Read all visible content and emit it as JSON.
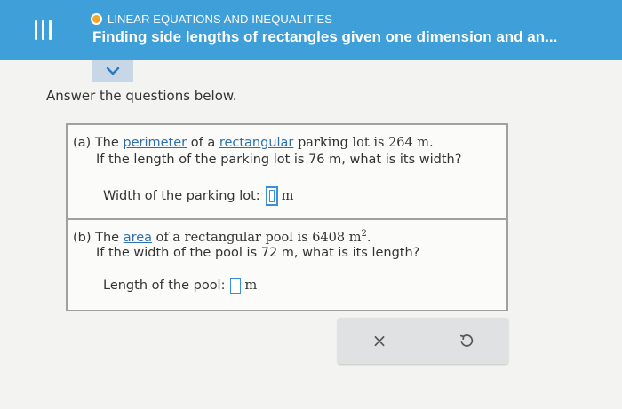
{
  "header": {
    "topic": "LINEAR EQUATIONS AND INEQUALITIES",
    "title": "Finding side lengths of rectangles given one dimension and an...",
    "menu_icon": "hamburger-menu-icon",
    "status_color": "#f5a623",
    "bar_color": "#3f9fd8"
  },
  "instructions": "Answer the questions below.",
  "part_a": {
    "label": "(a) The",
    "link1": "perimeter",
    "mid1": "of a",
    "link2": "rectangular",
    "rest": "parking lot is 264 m.",
    "line2": "If the length of the parking lot is 76 m, what is its width?",
    "answer_label": "Width of the parking lot:",
    "answer_value": "",
    "unit": "m"
  },
  "part_b": {
    "label": "(b) The",
    "link1": "area",
    "rest": "of a rectangular pool is 6408 m",
    "exponent": "2",
    "end": ".",
    "line2": "If the width of the pool is 72 m, what is its length?",
    "answer_label": "Length of the pool:",
    "answer_value": "",
    "unit": "m"
  },
  "actions": {
    "clear_symbol": "×",
    "clear_icon": "close-icon",
    "undo_icon": "undo-icon"
  }
}
